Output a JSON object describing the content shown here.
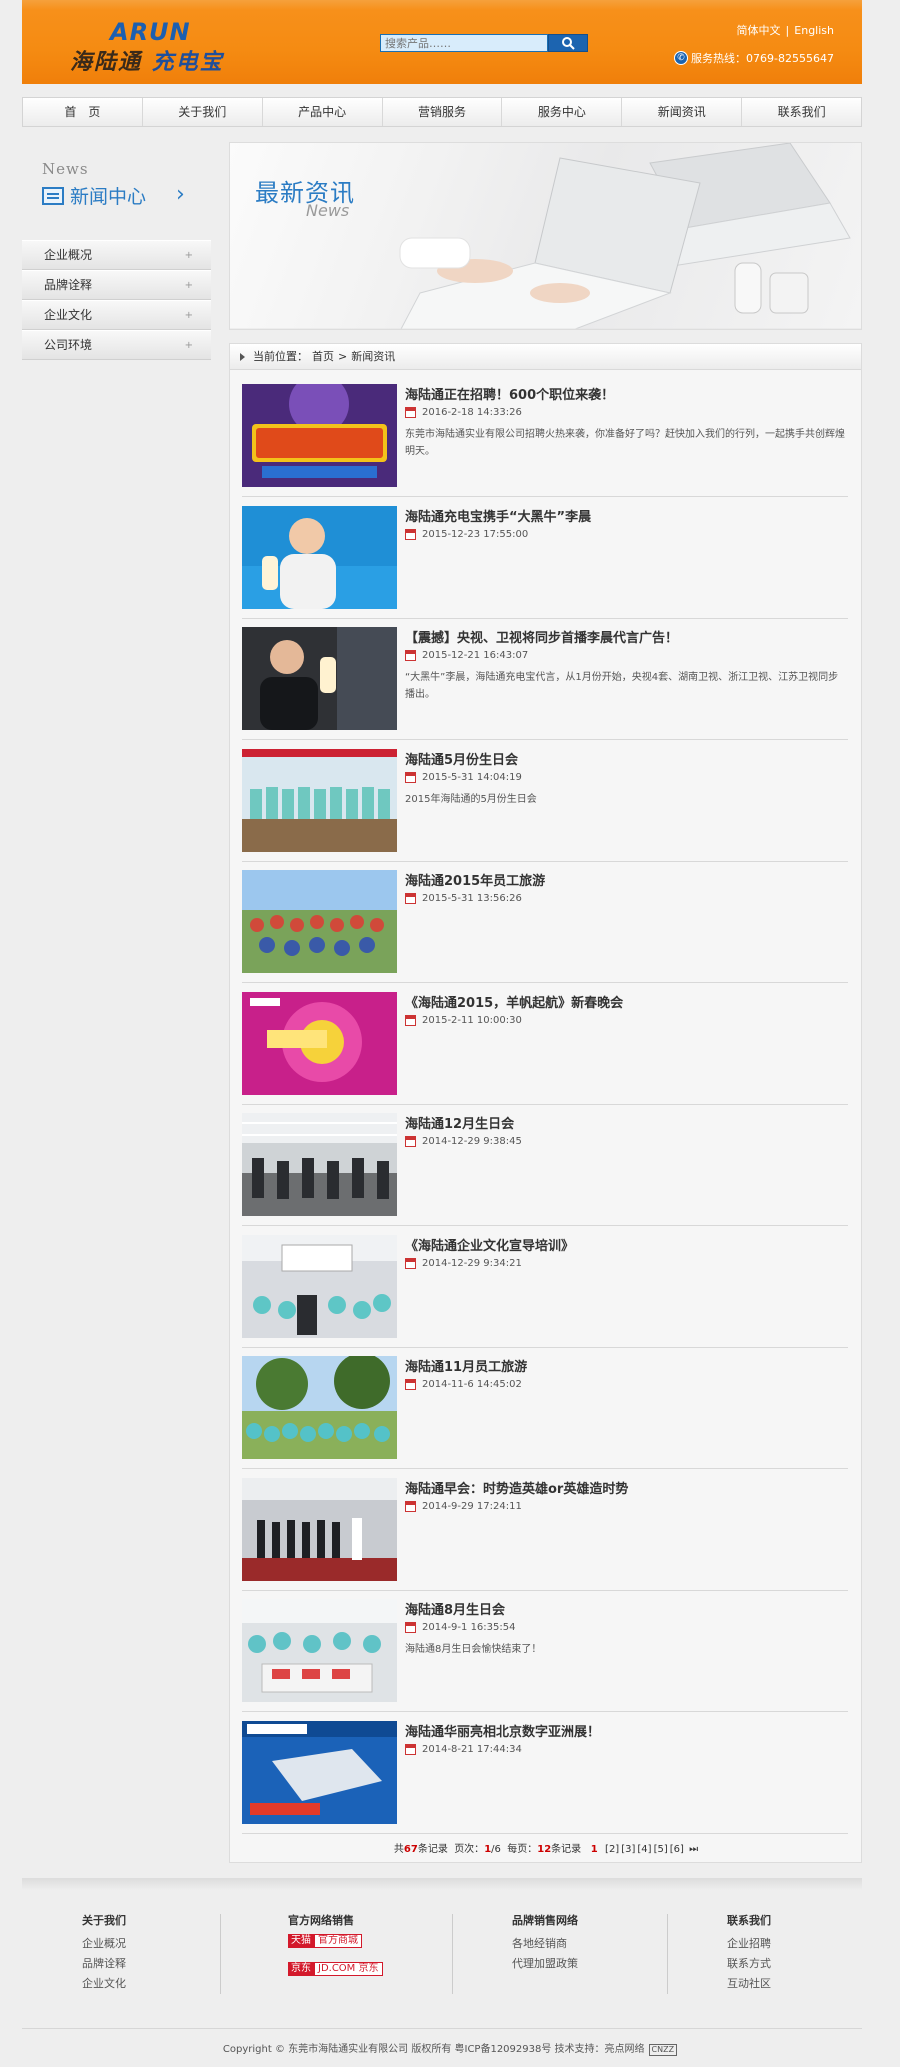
{
  "header": {
    "logo_en": "ARUN",
    "logo_cn_left": "海陆通",
    "logo_cn_right": "充电宝",
    "search_placeholder": "搜索产品……",
    "lang_cn": "简体中文",
    "lang_sep": "|",
    "lang_en": "English",
    "hotline": "服务热线：0769-82555647"
  },
  "nav": [
    "首　页",
    "关于我们",
    "产品中心",
    "营销服务",
    "服务中心",
    "新闻资讯",
    "联系我们"
  ],
  "sidebar": {
    "title_en": "News",
    "title_cn": "新闻中心",
    "items": [
      {
        "label": "企业概况"
      },
      {
        "label": "品牌诠释"
      },
      {
        "label": "企业文化"
      },
      {
        "label": "公司环境"
      }
    ]
  },
  "banner": {
    "title": "最新资讯",
    "subtitle": "News"
  },
  "breadcrumb": {
    "prefix": "当前位置：",
    "home": "首页",
    "sep": ">",
    "current": "新闻资讯"
  },
  "news": [
    {
      "title": "海陆通正在招聘！600个职位来袭！",
      "date": "2016-2-18 14:33:26",
      "desc": "东莞市海陆通实业有限公司招聘火热来袭，你准备好了吗？赶快加入我们的行列，一起携手共创辉煌明天。",
      "thumb": "recruit"
    },
    {
      "title": "海陆通充电宝携手“大黑牛”李晨",
      "date": "2015-12-23 17:55:00",
      "desc": "",
      "thumb": "portrait-blue"
    },
    {
      "title": "【震撼】央视、卫视将同步首播李晨代言广告！",
      "date": "2015-12-21 16:43:07",
      "desc": "“大黑牛”李晨，海陆通充电宝代言，从1月份开始，央视4套、湖南卫视、浙江卫视、江苏卫视同步播出。",
      "thumb": "portrait-dark"
    },
    {
      "title": "海陆通5月份生日会",
      "date": "2015-5-31 14:04:19",
      "desc": "2015年海陆通的5月份生日会",
      "thumb": "group-stage"
    },
    {
      "title": "海陆通2015年员工旅游",
      "date": "2015-5-31 13:56:26",
      "desc": "",
      "thumb": "group-outdoor"
    },
    {
      "title": "《海陆通2015，羊帆起航》新春晚会",
      "date": "2015-2-11 10:00:30",
      "desc": "",
      "thumb": "gala"
    },
    {
      "title": "海陆通12月生日会",
      "date": "2014-12-29 9:38:45",
      "desc": "",
      "thumb": "party-hall"
    },
    {
      "title": "《海陆通企业文化宣导培训》",
      "date": "2014-12-29 9:34:21",
      "desc": "",
      "thumb": "training"
    },
    {
      "title": "海陆通11月员工旅游",
      "date": "2014-11-6 14:45:02",
      "desc": "",
      "thumb": "trip-trees"
    },
    {
      "title": "海陆通早会：时势造英雄or英雄造时势",
      "date": "2014-9-29 17:24:11",
      "desc": "",
      "thumb": "meeting"
    },
    {
      "title": "海陆通8月生日会",
      "date": "2014-9-1 16:35:54",
      "desc": "海陆通8月生日会愉快结束了！",
      "thumb": "party-table"
    },
    {
      "title": "海陆通华丽亮相北京数字亚洲展！",
      "date": "2014-8-21 17:44:34",
      "desc": "",
      "thumb": "expo"
    }
  ],
  "pager": {
    "total_prefix": "共",
    "total": "67",
    "total_suffix": "条记录",
    "page_prefix": "页次：",
    "page_cur": "1",
    "page_total": "/6",
    "per_prefix": "每页：",
    "per": "12",
    "per_suffix": "条记录",
    "current": "1",
    "pages": [
      "[2]",
      "[3]",
      "[4]",
      "[5]",
      "[6]"
    ],
    "last": "⏭"
  },
  "footer": {
    "about_title": "关于我们",
    "about_links": [
      "企业概况",
      "品牌诠释",
      "企业文化"
    ],
    "shop_title": "官方网络销售",
    "tmall_a": "天猫",
    "tmall_b": "官方商城",
    "jd_a": "京东",
    "jd_b": "JD.COM 京东",
    "brand_title": "品牌销售网络",
    "brand_links": [
      "各地经销商",
      "代理加盟政策"
    ],
    "contact_title": "联系我们",
    "contact_links": [
      "企业招聘",
      "联系方式",
      "互动社区"
    ],
    "copyright": "Copyright © 东莞市海陆通实业有限公司 版权所有 粤ICP备12092938号  技术支持：亮点网络",
    "cnzz": "CNZZ"
  }
}
